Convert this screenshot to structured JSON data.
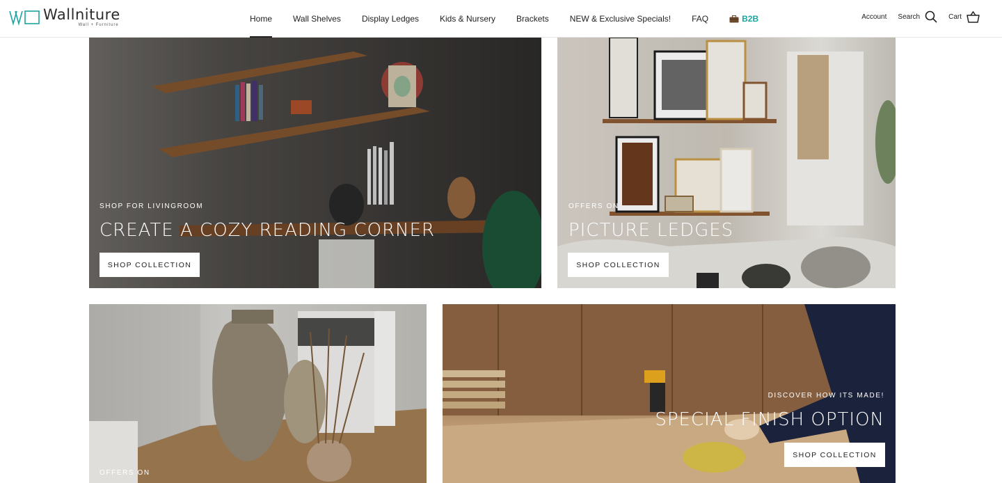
{
  "brand": {
    "name": "Wallniture",
    "tagline": "Wall + Furniture",
    "accent": "#1aa5a0"
  },
  "nav": {
    "items": [
      {
        "label": "Home",
        "active": true
      },
      {
        "label": "Wall Shelves",
        "active": false
      },
      {
        "label": "Display Ledges",
        "active": false
      },
      {
        "label": "Kids & Nursery",
        "active": false
      },
      {
        "label": "Brackets",
        "active": false
      },
      {
        "label": "NEW & Exclusive Specials!",
        "active": false
      },
      {
        "label": "FAQ",
        "active": false
      }
    ],
    "b2b": {
      "label": "B2B",
      "icon": "briefcase-icon"
    }
  },
  "utils": {
    "account": "Account",
    "search": {
      "label": "Search",
      "icon": "search-icon"
    },
    "cart": {
      "label": "Cart",
      "icon": "basket-icon"
    }
  },
  "tiles": [
    {
      "kicker": "SHOP FOR LIVINGROOM",
      "heading": "CREATE A COZY READING CORNER",
      "button": "SHOP COLLECTION"
    },
    {
      "kicker": "OFFERS ON",
      "heading": "PICTURE LEDGES",
      "button": "SHOP COLLECTION"
    },
    {
      "kicker": "OFFERS ON",
      "heading": "",
      "button": ""
    },
    {
      "kicker": "DISCOVER HOW ITS MADE!",
      "heading": "SPECIAL FINISH OPTION",
      "button": "SHOP COLLECTION"
    }
  ]
}
